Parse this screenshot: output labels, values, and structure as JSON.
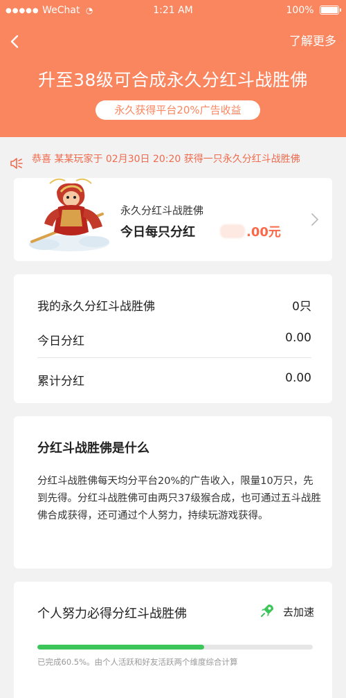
{
  "status_bar": {
    "carrier": "WeChat",
    "time": "1:21 AM",
    "battery": "100%"
  },
  "header": {
    "more_label": "了解更多",
    "title": "升至38级可合成永久分红斗战胜佛",
    "subtitle": "永久获得平台20%广告收益",
    "background_color": "#fa8660"
  },
  "notice": {
    "text": "恭喜  某某玩家于 02月30日 20:20 获得一只永久分红斗战胜佛"
  },
  "product": {
    "name": "永久分红斗战胜佛",
    "today_label": "今日每只分红",
    "today_value": ".00元"
  },
  "stats": {
    "rows": [
      {
        "label": "我的永久分红斗战胜佛",
        "value": "0只"
      },
      {
        "label": "今日分红",
        "value": "0.00"
      },
      {
        "label": "累计分红",
        "value": "0.00"
      }
    ]
  },
  "about": {
    "title": "分红斗战胜佛是什么",
    "body": "分红斗战胜佛每天均分平台20%的广告收入，限量10万只，先到先得。分红斗战胜佛可由两只37级猴合成，也可通过五斗战胜佛合成获得，还可通过个人努力，持续玩游戏获得。"
  },
  "effort": {
    "title": "个人努力必得分红斗战胜佛",
    "speed_label": "去加速",
    "progress": 0.605,
    "note": "已完成60.5%。由个人活跃和好友活跃两个维度综合计算",
    "accent_color": "#3cc65a"
  }
}
